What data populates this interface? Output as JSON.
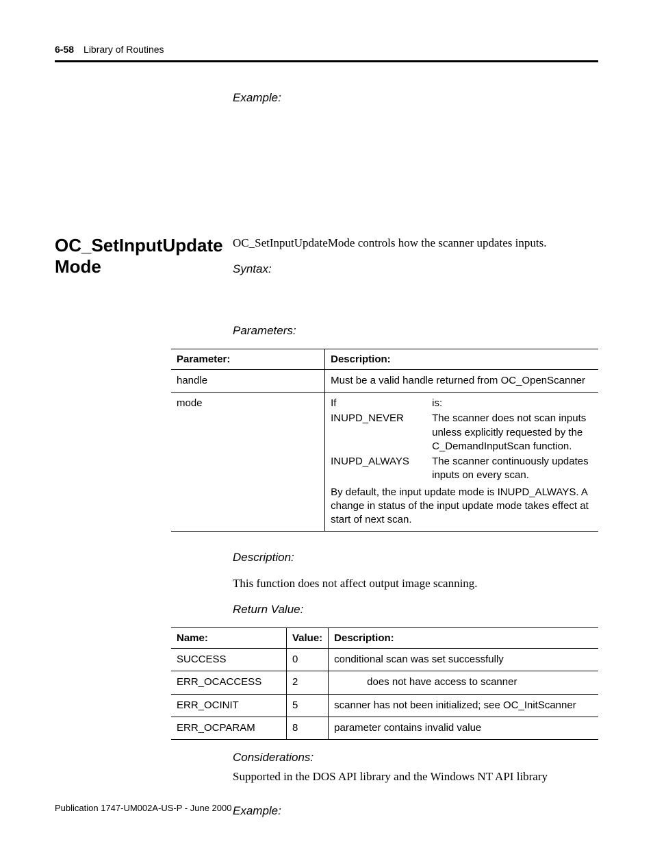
{
  "header": {
    "page_number": "6-58",
    "section": "Library of Routines"
  },
  "first_example_label": "Example:",
  "section": {
    "title": "OC_SetInputUpdate Mode",
    "intro": "OC_SetInputUpdateMode controls how the scanner updates inputs.",
    "syntax_label": "Syntax:",
    "parameters_label": "Parameters:",
    "description_label": "Description:",
    "description_body": "This function does not affect output image scanning.",
    "return_label": "Return Value:",
    "considerations_label": "Considerations:",
    "considerations_body": "Supported in the DOS API library and the Windows NT API library",
    "example_label": "Example:"
  },
  "param_table": {
    "headers": {
      "c1": "Parameter:",
      "c2": "Description:"
    },
    "rows": [
      {
        "param": "handle",
        "desc_plain": "Must be a valid handle returned from OC_OpenScanner"
      },
      {
        "param": "mode",
        "mode": {
          "if_label": "If",
          "is_label": "is:",
          "items": [
            {
              "name": "INUPD_NEVER",
              "desc": "The scanner does not scan inputs unless explicitly requested by the C_DemandInputScan function."
            },
            {
              "name": "INUPD_ALWAYS",
              "desc": "The scanner continuously updates inputs on every scan."
            }
          ],
          "footer": "By default, the input update mode is INUPD_ALWAYS. A change in status of the input update mode takes effect at start of next scan."
        }
      }
    ]
  },
  "return_table": {
    "headers": {
      "c1": "Name:",
      "c2": "Value:",
      "c3": "Description:"
    },
    "rows": [
      {
        "name": "SUCCESS",
        "value": "0",
        "desc": "conditional scan was set successfully"
      },
      {
        "name": "ERR_OCACCESS",
        "value": "2",
        "desc_indent": "does not have access to scanner"
      },
      {
        "name": "ERR_OCINIT",
        "value": "5",
        "desc": "scanner has not been initialized; see OC_InitScanner"
      },
      {
        "name": "ERR_OCPARAM",
        "value": "8",
        "desc": "parameter contains invalid value"
      }
    ]
  },
  "footer": {
    "pub": "Publication 1747-UM002A-US-P - June 2000"
  }
}
